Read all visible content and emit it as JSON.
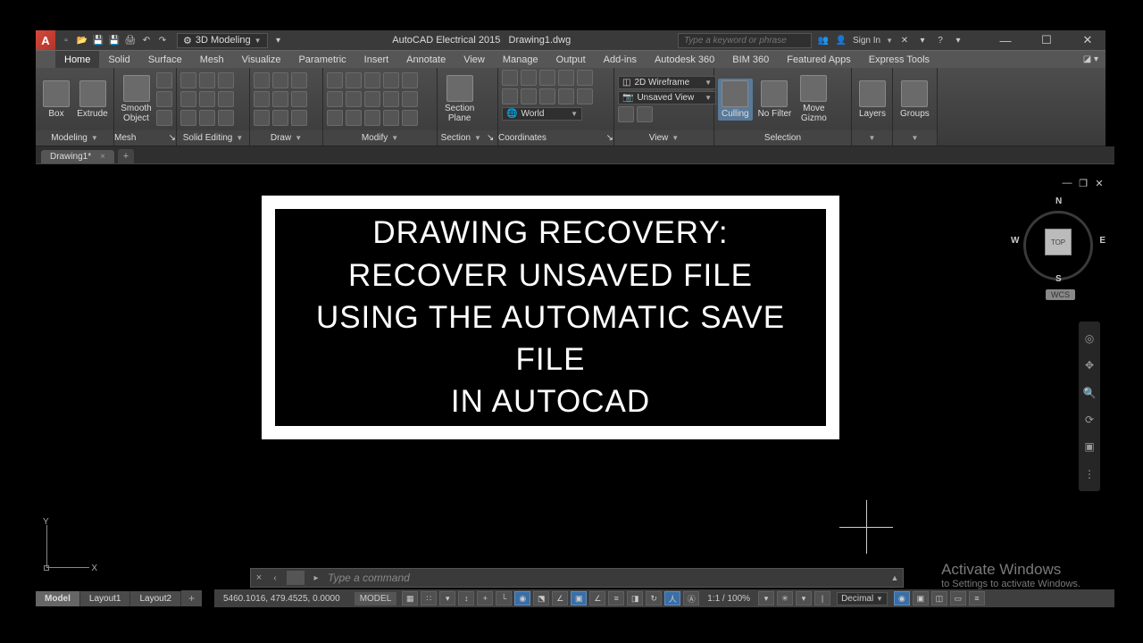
{
  "titlebar": {
    "workspace": "3D Modeling",
    "appname": "AutoCAD Electrical 2015",
    "filename": "Drawing1.dwg",
    "search_placeholder": "Type a keyword or phrase",
    "signin": "Sign In"
  },
  "ribbon": {
    "tabs": [
      "Home",
      "Solid",
      "Surface",
      "Mesh",
      "Visualize",
      "Parametric",
      "Insert",
      "Annotate",
      "View",
      "Manage",
      "Output",
      "Add-ins",
      "Autodesk 360",
      "BIM 360",
      "Featured Apps",
      "Express Tools"
    ],
    "panels": {
      "modeling": {
        "label": "Modeling",
        "box": "Box",
        "extrude": "Extrude"
      },
      "mesh": {
        "label": "Mesh",
        "smooth": "Smooth\nObject"
      },
      "solid_editing": {
        "label": "Solid Editing"
      },
      "draw": {
        "label": "Draw"
      },
      "modify": {
        "label": "Modify"
      },
      "section": {
        "label": "Section",
        "plane": "Section\nPlane"
      },
      "coordinates": {
        "label": "Coordinates",
        "world": "World"
      },
      "view": {
        "label": "View",
        "wire": "2D Wireframe",
        "unsaved": "Unsaved View"
      },
      "selection": {
        "label": "Selection",
        "culling": "Culling",
        "nofilter": "No Filter",
        "gizmo": "Move\nGizmo"
      },
      "layers": {
        "label": "Layers"
      },
      "groups": {
        "label": "Groups"
      }
    }
  },
  "filetabs": {
    "tab1": "Drawing1*"
  },
  "viewcube": {
    "top": "TOP",
    "n": "N",
    "s": "S",
    "e": "E",
    "w": "W",
    "wcs": "WCS"
  },
  "card": {
    "line1": "DRAWING RECOVERY:  RECOVER UNSAVED FILE",
    "line2": "USING THE AUTOMATIC SAVE FILE",
    "line3": "IN AUTOCAD"
  },
  "activate": {
    "t1": "Activate Windows",
    "t2": "to Settings to activate Windows."
  },
  "cmd": {
    "placeholder": "Type a command"
  },
  "layout": {
    "model": "Model",
    "l1": "Layout1",
    "l2": "Layout2"
  },
  "status": {
    "coords": "5460.1016, 479.4525, 0.0000",
    "space": "MODEL",
    "scale": "1:1 / 100%",
    "units": "Decimal"
  },
  "ucs": {
    "x": "X",
    "y": "Y"
  }
}
